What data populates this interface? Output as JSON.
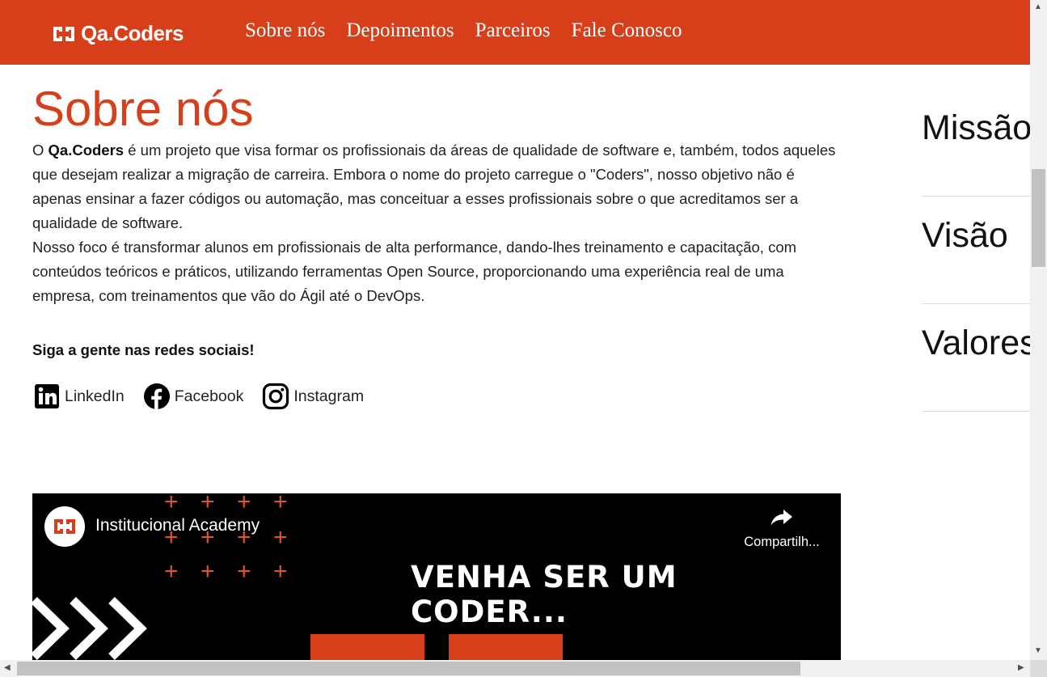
{
  "header": {
    "logo_text": "Qa.Coders",
    "nav": [
      "Sobre nós",
      "Depoimentos",
      "Parceiros",
      "Fale Conosco"
    ]
  },
  "about": {
    "title": "Sobre nós",
    "p1_prefix": "O ",
    "p1_brand": "Qa.Coders",
    "p1_rest": " é um projeto que visa formar os profissionais da áreas de qualidade de software e, também, todos aqueles que desejam realizar a migração de carreira. Embora o nome do projeto carregue o \"Coders\", nosso objetivo não é apenas ensinar a fazer códigos ou automação, mas conceituar a esses profissionais sobre o que acreditamos ser a qualidade de software.",
    "p2": "Nosso foco é transformar alunos em profissionais de alta performance, dando-lhes treinamento e capacitação, com conteúdos teóricos e práticos, utilizando ferramentas Open Source, proporcionando uma experiência real de uma empresa, com treinamentos que vão do Ágil até o DevOps.",
    "follow_label": "Siga a gente nas redes sociais!",
    "socials": [
      {
        "label": "LinkedIn",
        "icon": "linkedin-icon"
      },
      {
        "label": "Facebook",
        "icon": "facebook-icon"
      },
      {
        "label": "Instagram",
        "icon": "instagram-icon"
      }
    ]
  },
  "side_tabs": [
    "Missão",
    "Visão",
    "Valores"
  ],
  "video": {
    "channel_title": "Institucional Academy",
    "share_label": "Compartilh...",
    "headline": "VENHA SER UM CODER..."
  },
  "colors": {
    "brand": "#d63f1a",
    "accent_plus": "#e0552e"
  }
}
